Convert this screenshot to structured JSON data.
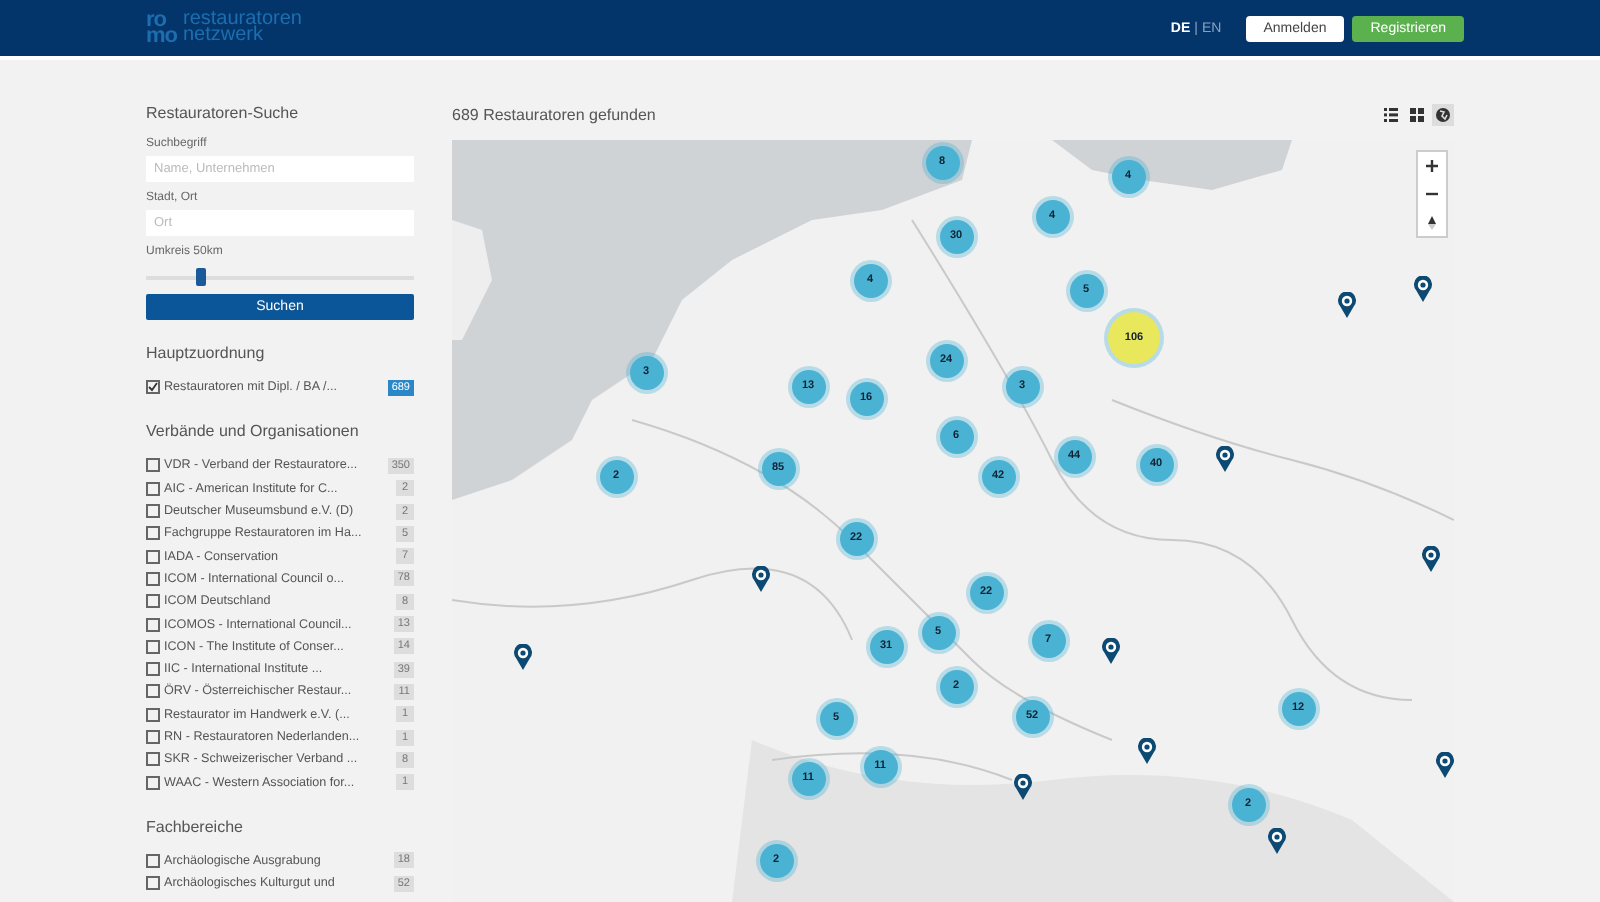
{
  "header": {
    "logo": {
      "mark_top": "ro",
      "mark_bottom": "mo",
      "line1": "restauratoren",
      "line2": "netzwerk"
    },
    "languages": [
      {
        "label": "DE",
        "selected": true
      },
      {
        "label": "EN",
        "selected": false
      }
    ],
    "language_separator": "|",
    "buttons": [
      {
        "label": "Anmelden",
        "kind": "secondary"
      },
      {
        "label": "Registrieren",
        "kind": "primary"
      }
    ]
  },
  "sidebar": {
    "title": "Restauratoren-Suche",
    "fields": [
      {
        "label": "Suchbegriff",
        "placeholder": "Name, Unternehmen"
      },
      {
        "label": "Stadt, Ort",
        "placeholder": "Ort"
      }
    ],
    "radius": {
      "label": "Umkreis 50km",
      "level": 0.2
    },
    "search_button": "Suchen",
    "groups": [
      {
        "title": "Hauptzuordnung",
        "items": [
          {
            "label": "Restauratoren mit Dipl. / BA /...",
            "count": "689",
            "checked": true
          }
        ]
      },
      {
        "title": "Verbände und Organisationen",
        "items": [
          {
            "label": "VDR - Verband der Restauratore...",
            "count": "350",
            "checked": false
          },
          {
            "label": "AIC - American Institute for C...",
            "count": "2",
            "checked": false
          },
          {
            "label": "Deutscher Museumsbund e.V. (D)",
            "count": "2",
            "checked": false
          },
          {
            "label": "Fachgruppe Restauratoren im Ha...",
            "count": "5",
            "checked": false
          },
          {
            "label": "IADA - Conservation",
            "count": "7",
            "checked": false
          },
          {
            "label": "ICOM - International Council o...",
            "count": "78",
            "checked": false
          },
          {
            "label": "ICOM Deutschland",
            "count": "8",
            "checked": false
          },
          {
            "label": "ICOMOS - International Council...",
            "count": "13",
            "checked": false
          },
          {
            "label": "ICON - The Institute of Conser...",
            "count": "14",
            "checked": false
          },
          {
            "label": "IIC - International Institute ...",
            "count": "39",
            "checked": false
          },
          {
            "label": "ÖRV - Österreichischer Restaur...",
            "count": "11",
            "checked": false
          },
          {
            "label": "Restaurator im Handwerk e.V. (...",
            "count": "1",
            "checked": false
          },
          {
            "label": "RN - Restauratoren Nederlanden...",
            "count": "1",
            "checked": false
          },
          {
            "label": "SKR - Schweizerischer Verband ...",
            "count": "8",
            "checked": false
          },
          {
            "label": "WAAC - Western Association for...",
            "count": "1",
            "checked": false
          }
        ]
      },
      {
        "title": "Fachbereiche",
        "items": [
          {
            "label": "Archäologische Ausgrabung",
            "count": "18",
            "checked": false
          },
          {
            "label": "Archäologisches Kulturgut und",
            "count": "52",
            "checked": false
          }
        ]
      }
    ]
  },
  "results": {
    "summary": "689 Restauratoren gefunden",
    "views": [
      {
        "kind": "list",
        "selected": false
      },
      {
        "kind": "grid",
        "selected": false
      },
      {
        "kind": "map",
        "selected": true
      }
    ]
  },
  "map": {
    "kind": "picture",
    "clusters": [
      {
        "count": "8",
        "color": "#4ab3d3"
      },
      {
        "count": "4",
        "color": "#4ab3d3"
      },
      {
        "count": "4",
        "color": "#4ab3d3"
      },
      {
        "count": "30",
        "color": "#4ab3d3"
      },
      {
        "count": "4",
        "color": "#4ab3d3"
      },
      {
        "count": "5",
        "color": "#4ab3d3"
      },
      {
        "count": "106",
        "color": "#e9e75c"
      },
      {
        "count": "3",
        "color": "#4ab3d3"
      },
      {
        "count": "24",
        "color": "#4ab3d3"
      },
      {
        "count": "3",
        "color": "#4ab3d3"
      },
      {
        "count": "13",
        "color": "#4ab3d3"
      },
      {
        "count": "16",
        "color": "#4ab3d3"
      },
      {
        "count": "6",
        "color": "#4ab3d3"
      },
      {
        "count": "44",
        "color": "#4ab3d3"
      },
      {
        "count": "2",
        "color": "#4ab3d3"
      },
      {
        "count": "85",
        "color": "#4ab3d3"
      },
      {
        "count": "42",
        "color": "#4ab3d3"
      },
      {
        "count": "40",
        "color": "#4ab3d3"
      },
      {
        "count": "22",
        "color": "#4ab3d3"
      },
      {
        "count": "22",
        "color": "#4ab3d3"
      },
      {
        "count": "5",
        "color": "#4ab3d3"
      },
      {
        "count": "31",
        "color": "#4ab3d3"
      },
      {
        "count": "7",
        "color": "#4ab3d3"
      },
      {
        "count": "2",
        "color": "#4ab3d3"
      },
      {
        "count": "12",
        "color": "#4ab3d3"
      },
      {
        "count": "5",
        "color": "#4ab3d3"
      },
      {
        "count": "52",
        "color": "#4ab3d3"
      },
      {
        "count": "11",
        "color": "#4ab3d3"
      },
      {
        "count": "11",
        "color": "#4ab3d3"
      },
      {
        "count": "2",
        "color": "#4ab3d3"
      },
      {
        "count": "2",
        "color": "#4ab3d3"
      }
    ]
  }
}
